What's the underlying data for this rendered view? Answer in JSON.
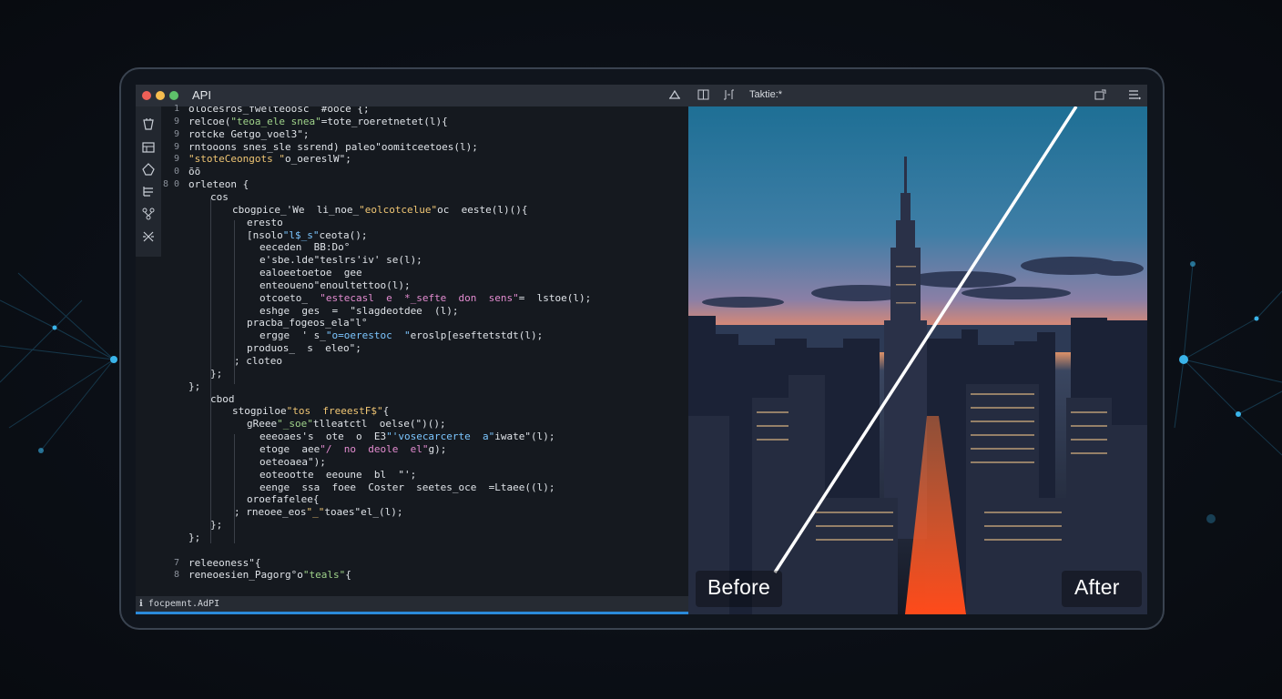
{
  "window": {
    "title": "API",
    "status": "ℹ focpemnt.AdPI",
    "traffic_lights": [
      "#ee5f57",
      "#f5bd4f",
      "#5ec16a"
    ]
  },
  "icons": {
    "toolbar_left": [
      "cloud-icon"
    ],
    "toolbar_right": [
      "split-view-icon",
      "compare-icon",
      "new-window-icon",
      "menu-icon"
    ],
    "activity_bar": [
      "cup-icon",
      "panel-icon",
      "shape-icon",
      "list-icon",
      "branch-icon",
      "tools-icon"
    ]
  },
  "preview": {
    "toolbar_label": "Taktie:*",
    "before_label": "Before",
    "after_label": "After"
  },
  "code": {
    "line_numbers": [
      "1",
      "9",
      "9",
      "9",
      "9",
      "0",
      "8 0",
      "",
      "",
      "",
      "",
      "",
      "",
      "",
      "",
      "",
      "",
      "",
      "",
      "",
      "",
      "",
      "",
      "",
      "",
      "",
      "",
      "",
      "",
      "",
      "",
      "",
      "",
      "",
      "",
      "",
      "7",
      "8"
    ],
    "lines": [
      "olocesros_fwelteoosc  #ooce {;",
      "relcoe(\"teoa_ele snea\"=tote_roeretnetet(l){",
      "rotcke Getgo_voel3\";",
      "rntooons snes_sle ssrend) paleo\"oomitceetoes(l);",
      "\"stoteCeongots \"o_oereslW\";",
      "ōō",
      "orleteon {",
      "cos",
      "cbogpice_'We  li_noe_\"eolcotcelue\"oc  eeste(l)(){",
      "eresto",
      "[nsolo\"l$_s\"ceota();",
      "eeceden  BB:Do°",
      "e'sbe.lde\"teslrs'iv' se(l);",
      "ealoeetoetoe  gee",
      "enteoueno\"enoultettoo(l);",
      "otcoeto_  \"estecasl  e  *_sefte  don  sens\"=  lstoe(l);",
      "eshge  ges  =  \"slagdeotdee  (l);",
      "pracba_fogeos_ela\"l°",
      "ergge  ' s_\"o=oerestoc  \"eroslp[eseftetstdt(l);",
      "produos_  s  eleo\";",
      "; cloteo",
      "};",
      "};",
      "cbod",
      "stogpiloe\"tos  freeestF$\"{",
      "gReee\"_soe\"tlleatctl  oelse(\")();",
      "eeeoaes's  ote  o  E3\"'vosecarcerte  a\"iwate\"(l);",
      "etoge  aee\"/  no  deole  el\"g);",
      "oeteoaea\");",
      "eoteootte  eeoune  bl  \"';",
      "eenge  ssa  foee  Coster  seetes_oce  =Ltaee((l);",
      "oroefafelee{",
      "; rneoee_eos\"_\"toaes\"el_(l);",
      "};",
      "};",
      "",
      "releeoness\"{",
      "reneoesien_Pagorg°o\"teals\"{"
    ]
  }
}
